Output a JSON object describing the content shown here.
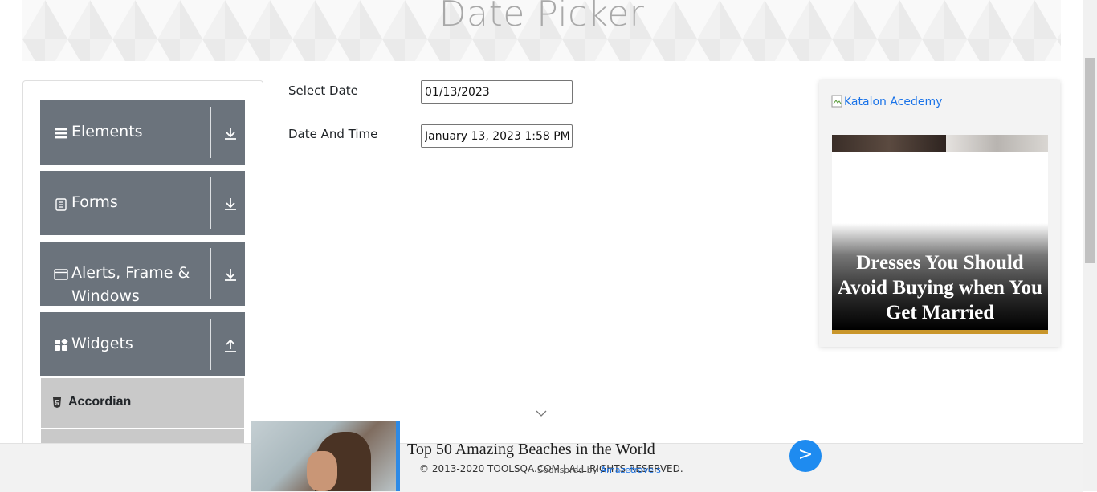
{
  "header": {
    "title": "Date Picker"
  },
  "sidebar": {
    "groups": [
      {
        "label": "Elements",
        "icon": "hamburger-icon",
        "expanded": false
      },
      {
        "label": "Forms",
        "icon": "form-icon",
        "expanded": false
      },
      {
        "label": "Alerts, Frame & Windows",
        "icon": "window-icon",
        "expanded": false
      },
      {
        "label": "Widgets",
        "icon": "widgets-icon",
        "expanded": true
      }
    ],
    "widget_items": [
      {
        "label": "Accordian",
        "icon": "html5-icon"
      }
    ]
  },
  "form": {
    "select_date": {
      "label": "Select Date",
      "value": "01/13/2023"
    },
    "date_time": {
      "label": "Date And Time",
      "value": "January 13, 2023 1:58 PM"
    }
  },
  "ad_right": {
    "image_alt": "Katalon Acedemy",
    "headline": "Dresses You Should Avoid Buying when You Get Married"
  },
  "footer": {
    "copyright": "© 2013-2020 TOOLSQA.COM | ALL RIGHTS RESERVED."
  },
  "bottom_ad": {
    "title": "Top 50 Amazing Beaches in the World",
    "sponsored_prefix": "Sponsored by",
    "sponsored_brand": "Amazetravels",
    "go_label": ">"
  },
  "colors": {
    "sidebar_group_bg": "#6b737c",
    "menu_item_bg": "#c9c9c9",
    "link": "#1a73e8",
    "ad_button": "#1e8bf0",
    "banner_title": "#a9a9a9"
  }
}
